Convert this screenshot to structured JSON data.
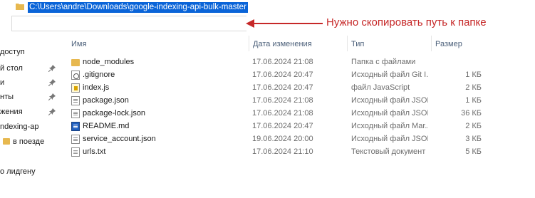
{
  "address_bar": {
    "path": "C:\\Users\\andre\\Downloads\\google-indexing-api-bulk-master"
  },
  "annotation": {
    "text": "Нужно скопировать путь к папке",
    "color": "#c62828"
  },
  "columns": {
    "name": "Имя",
    "date": "Дата изменения",
    "type": "Тип",
    "size": "Размер"
  },
  "nav": {
    "items": [
      {
        "label": "доступ",
        "pinned": false
      },
      {
        "label": "й стол",
        "pinned": true
      },
      {
        "label": "и",
        "pinned": true
      },
      {
        "label": "нты",
        "pinned": true
      },
      {
        "label": "жения",
        "pinned": true
      },
      {
        "label": "ndexing-ap",
        "pinned": false,
        "icon": "folder-icon"
      },
      {
        "label": "в поезде",
        "pinned": false
      },
      {
        "label": "о лидгену",
        "pinned": false
      }
    ]
  },
  "files": [
    {
      "name": "node_modules",
      "date": "17.06.2024 21:08",
      "type": "Папка с файлами",
      "size": "",
      "icon": "folder-icon"
    },
    {
      "name": ".gitignore",
      "date": "17.06.2024 20:47",
      "type": "Исходный файл Git I...",
      "size": "1 КБ",
      "icon": "settings-file-icon"
    },
    {
      "name": "index.js",
      "date": "17.06.2024 20:47",
      "type": "файл JavaScript",
      "size": "2 КБ",
      "icon": "js-file-icon"
    },
    {
      "name": "package.json",
      "date": "17.06.2024 21:08",
      "type": "Исходный файл JSON",
      "size": "1 КБ",
      "icon": "json-file-icon"
    },
    {
      "name": "package-lock.json",
      "date": "17.06.2024 21:08",
      "type": "Исходный файл JSON",
      "size": "36 КБ",
      "icon": "json-file-icon"
    },
    {
      "name": "README.md",
      "date": "17.06.2024 20:47",
      "type": "Исходный файл Mar...",
      "size": "2 КБ",
      "icon": "markdown-file-icon"
    },
    {
      "name": "service_account.json",
      "date": "19.06.2024 20:00",
      "type": "Исходный файл JSON",
      "size": "3 КБ",
      "icon": "json-file-icon"
    },
    {
      "name": "urls.txt",
      "date": "17.06.2024 21:10",
      "type": "Текстовый документ",
      "size": "5 КБ",
      "icon": "text-file-icon"
    }
  ]
}
